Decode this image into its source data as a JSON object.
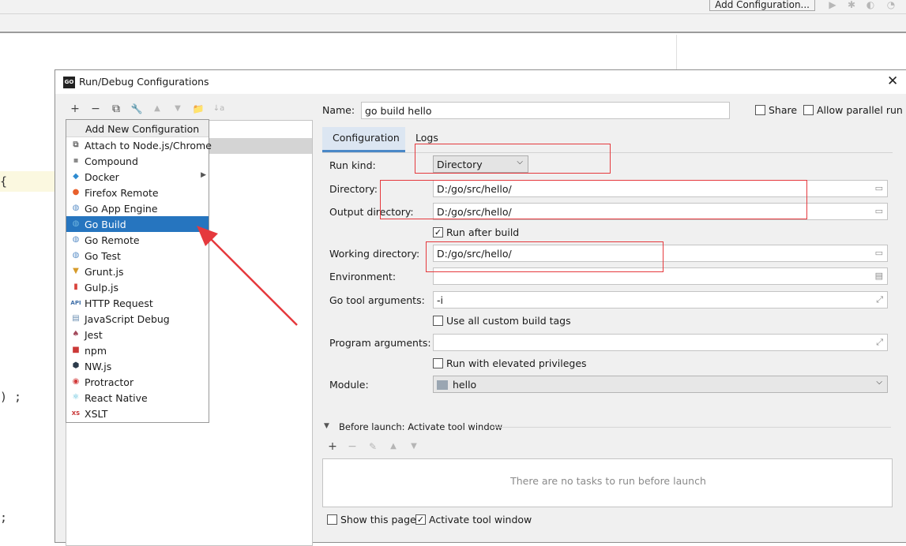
{
  "ide": {
    "add_configuration": "Add Configuration...",
    "code_glyphs": [
      "{",
      ") ;",
      ";"
    ]
  },
  "dialog": {
    "title": "Run/Debug Configurations",
    "logo": "GO",
    "close": "✕"
  },
  "toolbar": {
    "add": "+",
    "remove": "−",
    "copy": "⧉",
    "edit": "🔧",
    "up": "▲",
    "down": "▼",
    "folder": "📁",
    "sort": "↓a"
  },
  "popup": {
    "header": "Add New Configuration",
    "items": [
      {
        "label": "Attach to Node.js/Chrome",
        "icon": "attach-node-icon",
        "glyph": "⧉",
        "color": "#6e6e6e",
        "has_submenu": false
      },
      {
        "label": "Compound",
        "icon": "compound-icon",
        "glyph": "▪",
        "color": "#8a8a8a",
        "has_submenu": false
      },
      {
        "label": "Docker",
        "icon": "docker-icon",
        "glyph": "◆",
        "color": "#2e8bd0",
        "has_submenu": true
      },
      {
        "label": "Firefox Remote",
        "icon": "firefox-icon",
        "glyph": "●",
        "color": "#e8602c",
        "has_submenu": false
      },
      {
        "label": "Go App Engine",
        "icon": "go-app-engine-icon",
        "glyph": "◍",
        "color": "#5b8fc7",
        "has_submenu": false
      },
      {
        "label": "Go Build",
        "icon": "go-build-icon",
        "glyph": "◍",
        "color": "#6fb5e0",
        "has_submenu": false,
        "selected": true
      },
      {
        "label": "Go Remote",
        "icon": "go-remote-icon",
        "glyph": "◍",
        "color": "#5b8fc7",
        "has_submenu": false
      },
      {
        "label": "Go Test",
        "icon": "go-test-icon",
        "glyph": "◍",
        "color": "#5b8fc7",
        "has_submenu": false
      },
      {
        "label": "Grunt.js",
        "icon": "grunt-icon",
        "glyph": "▼",
        "color": "#d69b2a",
        "has_submenu": false
      },
      {
        "label": "Gulp.js",
        "icon": "gulp-icon",
        "glyph": "▮",
        "color": "#d8433c",
        "has_submenu": false
      },
      {
        "label": "HTTP Request",
        "icon": "http-request-icon",
        "glyph": "API",
        "color": "#3f6fa8",
        "has_submenu": false
      },
      {
        "label": "JavaScript Debug",
        "icon": "javascript-debug-icon",
        "glyph": "▤",
        "color": "#6b8fb3",
        "has_submenu": false
      },
      {
        "label": "Jest",
        "icon": "jest-icon",
        "glyph": "♠",
        "color": "#a34a5c",
        "has_submenu": false
      },
      {
        "label": "npm",
        "icon": "npm-icon",
        "glyph": "■",
        "color": "#cb3837",
        "has_submenu": false
      },
      {
        "label": "NW.js",
        "icon": "nwjs-icon",
        "glyph": "⬢",
        "color": "#2b3a4a",
        "has_submenu": false
      },
      {
        "label": "Protractor",
        "icon": "protractor-icon",
        "glyph": "◉",
        "color": "#d23a3a",
        "has_submenu": false
      },
      {
        "label": "React Native",
        "icon": "react-native-icon",
        "glyph": "⚛",
        "color": "#48b8d8",
        "has_submenu": false
      },
      {
        "label": "XSLT",
        "icon": "xslt-icon",
        "glyph": "XS",
        "color": "#c62e2e",
        "has_submenu": false
      }
    ]
  },
  "form": {
    "name_label": "Name:",
    "name_value": "go build hello",
    "share_label": "Share",
    "share_checked": false,
    "parallel_label": "Allow parallel run",
    "parallel_checked": false,
    "tabs": [
      "Configuration",
      "Logs"
    ],
    "run_kind_label": "Run kind:",
    "run_kind_value": "Directory",
    "directory_label": "Directory:",
    "directory_value": "D:/go/src/hello/",
    "output_directory_label": "Output directory:",
    "output_directory_value": "D:/go/src/hello/",
    "run_after_build_label": "Run after build",
    "run_after_build_checked": true,
    "working_directory_label": "Working directory:",
    "working_directory_value": "D:/go/src/hello/",
    "environment_label": "Environment:",
    "environment_value": "",
    "go_tool_args_label": "Go tool arguments:",
    "go_tool_args_value": "-i",
    "custom_build_tags_label": "Use all custom build tags",
    "custom_build_tags_checked": false,
    "program_args_label": "Program arguments:",
    "program_args_value": "",
    "elevated_label": "Run with elevated privileges",
    "elevated_checked": false,
    "module_label": "Module:",
    "module_value": "hello"
  },
  "before_launch": {
    "header": "Before launch: Activate tool window",
    "empty_text": "There are no tasks to run before launch",
    "show_page_label": "Show this page",
    "show_page_checked": false,
    "activate_label": "Activate tool window",
    "activate_checked": true
  },
  "colors": {
    "selection": "#2675bf",
    "annotation_red": "#e5393d",
    "tab_active_bg": "#dce6f2"
  }
}
